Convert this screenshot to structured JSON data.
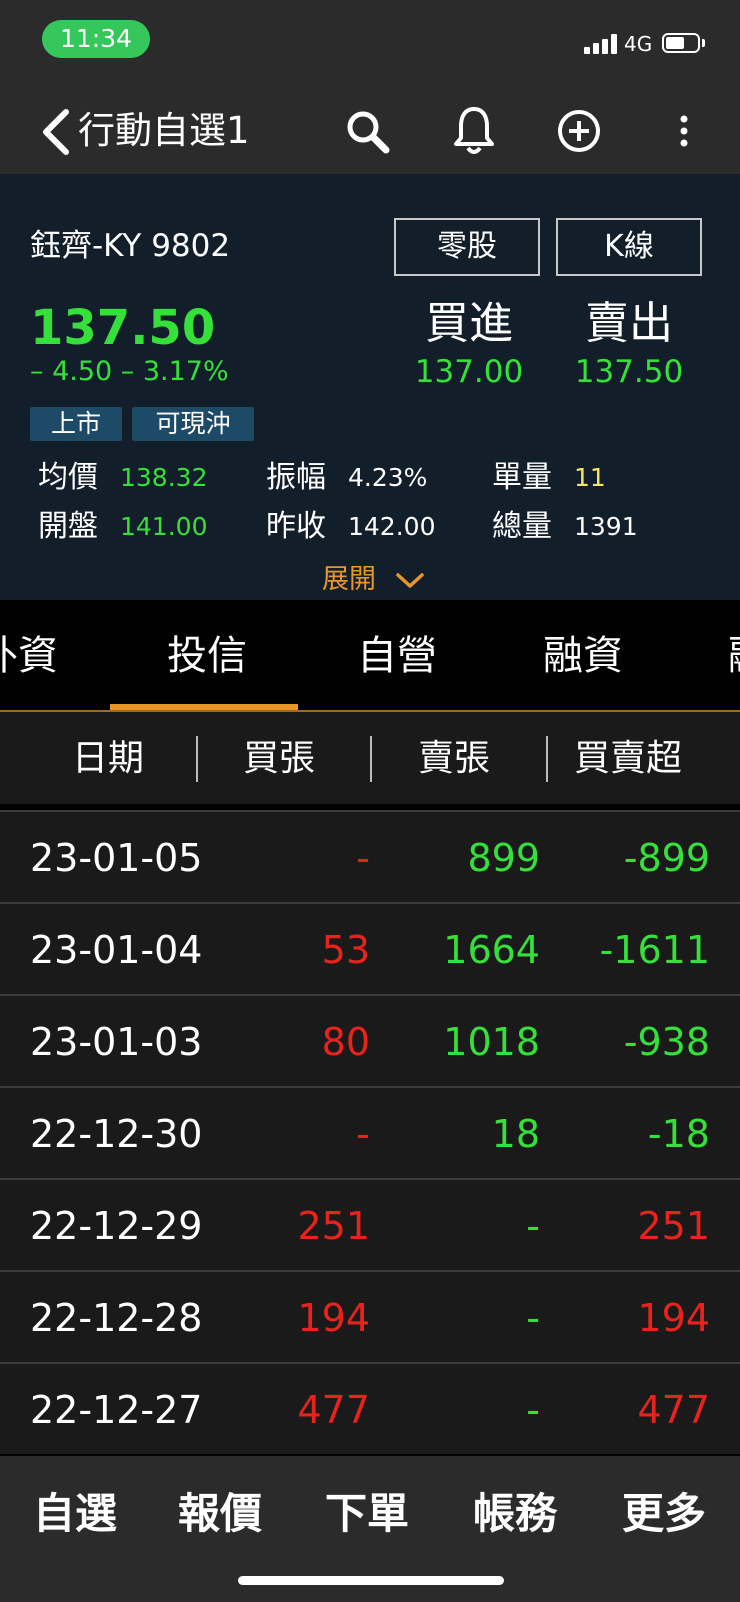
{
  "status_bar": {
    "time": "11:34",
    "network": "4G"
  },
  "nav": {
    "title": "行動自選1"
  },
  "quote": {
    "stock_name": "鈺齊-KY 9802",
    "odd_lot_button": "零股",
    "kline_button": "K線",
    "price": "137.50",
    "change": "– 4.50  – 3.17%",
    "buy_label": "買進",
    "sell_label": "賣出",
    "buy_price": "137.00",
    "sell_price": "137.50",
    "tags": [
      "上市",
      "可現沖"
    ],
    "stats": [
      {
        "label": "均價",
        "value": "138.32"
      },
      {
        "label": "振幅",
        "value": "4.23%"
      },
      {
        "label": "單量",
        "value": "11"
      },
      {
        "label": "開盤",
        "value": "141.00"
      },
      {
        "label": "昨收",
        "value": "142.00"
      },
      {
        "label": "總量",
        "value": "1391"
      }
    ],
    "expand_label": "展開"
  },
  "tabs": [
    "外資",
    "投信",
    "自營",
    "融資",
    "融"
  ],
  "active_tab": "投信",
  "table": {
    "headers": [
      "日期",
      "買張",
      "賣張",
      "買賣超"
    ],
    "rows": [
      {
        "date": "23-01-05",
        "buy": "-",
        "sell": "899",
        "net": "-899"
      },
      {
        "date": "23-01-04",
        "buy": "53",
        "sell": "1664",
        "net": "-1611"
      },
      {
        "date": "23-01-03",
        "buy": "80",
        "sell": "1018",
        "net": "-938"
      },
      {
        "date": "22-12-30",
        "buy": "-",
        "sell": "18",
        "net": "-18"
      },
      {
        "date": "22-12-29",
        "buy": "251",
        "sell": "-",
        "net": "251"
      },
      {
        "date": "22-12-28",
        "buy": "194",
        "sell": "-",
        "net": "194"
      },
      {
        "date": "22-12-27",
        "buy": "477",
        "sell": "-",
        "net": "477"
      }
    ]
  },
  "bottom_tabs": [
    "自選",
    "報價",
    "下單",
    "帳務",
    "更多"
  ],
  "colors": {
    "up": "#e8231d",
    "down": "#35e03a",
    "accent": "#e8962a",
    "tag_bg": "#1d4a66"
  }
}
